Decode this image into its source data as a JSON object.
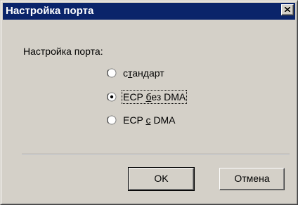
{
  "window": {
    "title": "Настройка порта",
    "close_icon": "close-x-icon"
  },
  "group": {
    "label": "Настройка порта:"
  },
  "options": [
    {
      "pre": "с",
      "accel": "т",
      "post": "андарт",
      "selected": false
    },
    {
      "pre": "ECP ",
      "accel": "б",
      "post": "ез DMA",
      "selected": true
    },
    {
      "pre": "ECP ",
      "accel": "с",
      "post": " DMA",
      "selected": false
    }
  ],
  "buttons": {
    "ok_label": "OK",
    "cancel_label": "Отмена"
  },
  "colors": {
    "titlebar": "#0a246a",
    "face": "#d4d0c8"
  }
}
